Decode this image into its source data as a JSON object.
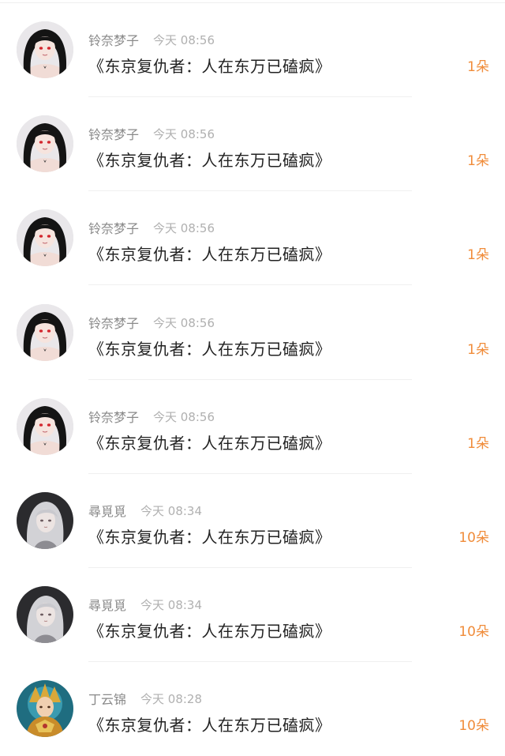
{
  "records": [
    {
      "username": "铃奈梦子",
      "time": "今天 08:56",
      "title": "《东京复仇者：人在东万已磕疯》",
      "amount": "1朵",
      "avatar": "anime-girl-black-hair-avatar"
    },
    {
      "username": "铃奈梦子",
      "time": "今天 08:56",
      "title": "《东京复仇者：人在东万已磕疯》",
      "amount": "1朵",
      "avatar": "anime-girl-black-hair-avatar"
    },
    {
      "username": "铃奈梦子",
      "time": "今天 08:56",
      "title": "《东京复仇者：人在东万已磕疯》",
      "amount": "1朵",
      "avatar": "anime-girl-black-hair-avatar"
    },
    {
      "username": "铃奈梦子",
      "time": "今天 08:56",
      "title": "《东京复仇者：人在东万已磕疯》",
      "amount": "1朵",
      "avatar": "anime-girl-black-hair-avatar"
    },
    {
      "username": "铃奈梦子",
      "time": "今天 08:56",
      "title": "《东京复仇者：人在东万已磕疯》",
      "amount": "1朵",
      "avatar": "anime-girl-black-hair-avatar"
    },
    {
      "username": "尋覓覓",
      "time": "今天 08:34",
      "title": "《东京复仇者：人在东万已磕疯》",
      "amount": "10朵",
      "avatar": "silver-hair-girl-avatar"
    },
    {
      "username": "尋覓覓",
      "time": "今天 08:34",
      "title": "《东京复仇者：人在东万已磕疯》",
      "amount": "10朵",
      "avatar": "silver-hair-girl-avatar"
    },
    {
      "username": "丁云锦",
      "time": "今天 08:28",
      "title": "《东京复仇者：人在东万已磕疯》",
      "amount": "10朵",
      "avatar": "golden-warrior-avatar"
    }
  ],
  "colors": {
    "amount": "#f08c3a",
    "username": "#8a8a8a",
    "time": "#b0b0b0",
    "title": "#222222"
  }
}
